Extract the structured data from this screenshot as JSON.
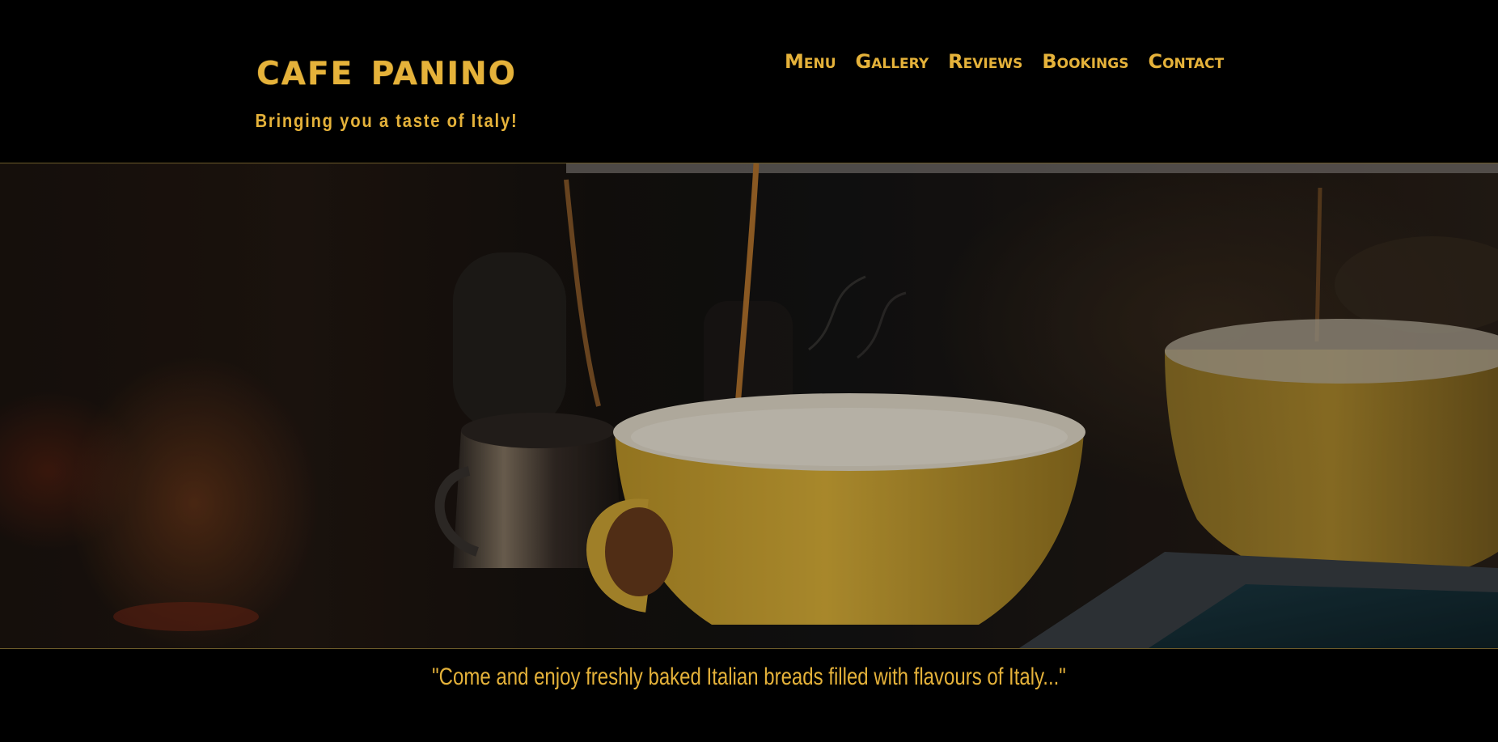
{
  "brand": {
    "name": "Cafe Panino",
    "tagline": "Bringing you a taste of Italy!"
  },
  "nav": {
    "items": [
      {
        "label": "Menu"
      },
      {
        "label": "Gallery"
      },
      {
        "label": "Reviews"
      },
      {
        "label": "Bookings"
      },
      {
        "label": "Contact"
      }
    ]
  },
  "hero": {
    "image": "espresso-pouring-into-yellow-cup-photo"
  },
  "quote": {
    "text": "\"Come and enjoy freshly baked Italian breads filled with flavours of Italy...\""
  },
  "colors": {
    "accent": "#e5b23a",
    "background": "#000000"
  }
}
